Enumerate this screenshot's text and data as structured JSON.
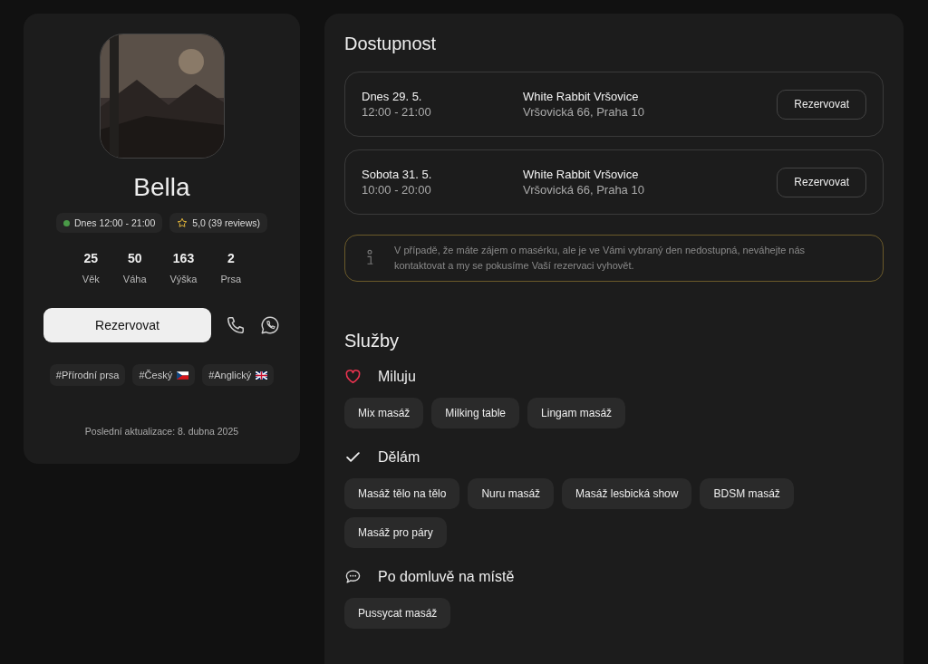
{
  "profile": {
    "name": "Bella",
    "status": {
      "text": "Dnes 12:00 - 21:00",
      "available": true
    },
    "rating": "5,0 (39 reviews)",
    "stats": [
      {
        "value": "25",
        "label": "Věk"
      },
      {
        "value": "50",
        "label": "Váha"
      },
      {
        "value": "163",
        "label": "Výška"
      },
      {
        "value": "2",
        "label": "Prsa"
      }
    ],
    "book_button": "Rezervovat",
    "tags": [
      {
        "text": "#Přírodní prsa"
      },
      {
        "text": "#Český",
        "kind": "czech-flag"
      },
      {
        "text": "#Anglický",
        "kind": "british-flag"
      }
    ],
    "updated": "Poslední aktualizace: 8. dubna 2025"
  },
  "availability": {
    "title": "Dostupnost",
    "slots": [
      {
        "day": "Dnes 29. 5.",
        "time": "12:00 - 21:00",
        "place": "White Rabbit Vršovice",
        "address": "Vršovická 66, Praha 10",
        "button": "Rezervovat"
      },
      {
        "day": "Sobota 31. 5.",
        "time": "10:00 - 20:00",
        "place": "White Rabbit Vršovice",
        "address": "Vršovická 66, Praha 10",
        "button": "Rezervovat"
      }
    ],
    "notice": "V případě, že máte zájem o masérku, ale je ve Vámi vybraný den nedostupná, neváhejte nás kontaktovat a my se pokusíme Vaší rezervaci vyhovět."
  },
  "services": {
    "title": "Služby",
    "groups": [
      {
        "kind": "love",
        "title": "Miluju",
        "items": [
          "Mix masáž",
          "Milking table",
          "Lingam masáž"
        ]
      },
      {
        "kind": "do",
        "title": "Dělám",
        "items": [
          "Masáž tělo na tělo",
          "Nuru masáž",
          "Masáž lesbická show",
          "BDSM masáž",
          "Masáž pro páry"
        ]
      },
      {
        "kind": "ask",
        "title": "Po domluvě na místě",
        "items": [
          "Pussycat masáž"
        ]
      }
    ]
  }
}
